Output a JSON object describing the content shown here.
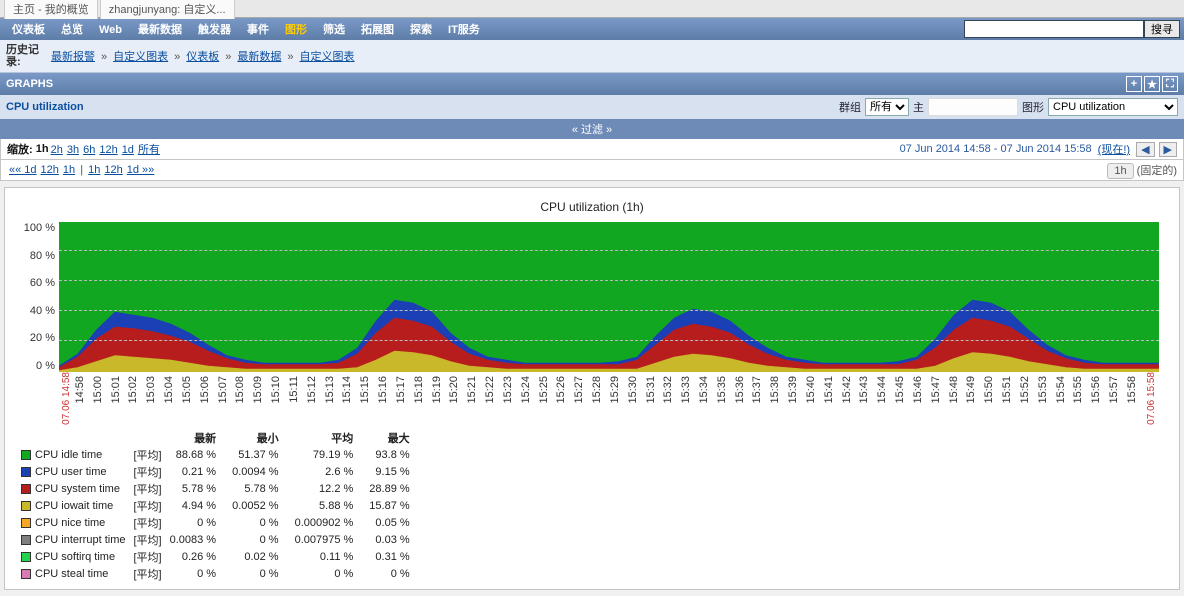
{
  "topTabs": [
    "主页 - 我的概览",
    "zhangjunyang: 自定义..."
  ],
  "menu": [
    "仪表板",
    "总览",
    "Web",
    "最新数据",
    "触发器",
    "事件",
    "图形",
    "筛选",
    "拓展图",
    "探索",
    "IT服务"
  ],
  "menuActive": "图形",
  "searchBtn": "搜寻",
  "history": {
    "label": "历史记录:",
    "items": [
      "最新报警",
      "自定义图表",
      "仪表板",
      "最新数据",
      "自定义图表"
    ]
  },
  "barTitle": "GRAPHS",
  "subbar": {
    "title": "CPU utilization",
    "groupLabel": "群组",
    "groupValue": "所有",
    "hostLabel": "主",
    "hostValue": "",
    "graphLabel": "图形",
    "graphValue": "CPU utilization"
  },
  "filterLabel": "« 过滤 »",
  "zoom": {
    "label": "缩放:",
    "active": "1h",
    "options": [
      "2h",
      "3h",
      "6h",
      "12h",
      "1d",
      "所有"
    ],
    "range": "07 Jun 2014 14:58  -  07 Jun 2014 15:58",
    "now": "(现在!)"
  },
  "pager": {
    "left": [
      "«« 1d",
      "12h",
      "1h",
      " | ",
      "1h",
      "12h",
      "1d »»"
    ],
    "right": "1h",
    "fixed": "(固定的)"
  },
  "chart_data": {
    "type": "area",
    "title": "CPU utilization (1h)",
    "ylabel": "",
    "ylim": [
      0,
      100
    ],
    "yticks": [
      0,
      20,
      40,
      60,
      80,
      100
    ],
    "x": [
      "14:58",
      "15:00",
      "15:01",
      "15:02",
      "15:03",
      "15:04",
      "15:05",
      "15:06",
      "15:07",
      "15:08",
      "15:09",
      "15:10",
      "15:11",
      "15:12",
      "15:13",
      "15:14",
      "15:15",
      "15:16",
      "15:17",
      "15:18",
      "15:19",
      "15:20",
      "15:21",
      "15:22",
      "15:23",
      "15:24",
      "15:25",
      "15:26",
      "15:27",
      "15:28",
      "15:29",
      "15:30",
      "15:31",
      "15:32",
      "15:33",
      "15:34",
      "15:35",
      "15:36",
      "15:37",
      "15:38",
      "15:39",
      "15:40",
      "15:41",
      "15:42",
      "15:43",
      "15:44",
      "15:45",
      "15:46",
      "15:47",
      "15:48",
      "15:49",
      "15:50",
      "15:51",
      "15:52",
      "15:53",
      "15:54",
      "15:55",
      "15:56",
      "15:57",
      "15:58"
    ],
    "x_start": "07.06 14:58",
    "x_end": "07.06 15:58",
    "series": [
      {
        "name": "CPU iowait time",
        "color": "#c9b82a",
        "values": [
          1,
          3,
          7,
          11,
          10,
          9,
          8,
          6,
          4,
          3,
          2,
          2,
          2,
          2,
          2,
          2,
          3,
          8,
          14,
          13,
          11,
          7,
          4,
          3,
          2,
          2,
          2,
          2,
          2,
          2,
          2,
          2,
          6,
          10,
          12,
          11,
          9,
          6,
          4,
          3,
          2,
          2,
          2,
          2,
          2,
          2,
          2,
          4,
          9,
          13,
          12,
          10,
          7,
          5,
          3,
          2,
          2,
          2,
          2,
          2
        ]
      },
      {
        "name": "CPU system time",
        "color": "#b81d1d",
        "values": [
          3,
          10,
          22,
          30,
          29,
          27,
          24,
          20,
          14,
          9,
          6,
          5,
          5,
          5,
          5,
          6,
          12,
          26,
          36,
          34,
          30,
          20,
          12,
          8,
          6,
          5,
          5,
          5,
          5,
          5,
          5,
          8,
          18,
          28,
          32,
          30,
          26,
          18,
          12,
          8,
          6,
          5,
          5,
          5,
          5,
          5,
          8,
          16,
          28,
          36,
          34,
          30,
          22,
          14,
          9,
          6,
          5,
          5,
          5,
          5
        ]
      },
      {
        "name": "CPU user time",
        "color": "#1b3fb5",
        "values": [
          4,
          12,
          28,
          40,
          38,
          36,
          32,
          26,
          18,
          11,
          8,
          6,
          6,
          6,
          6,
          8,
          16,
          34,
          48,
          46,
          40,
          26,
          16,
          10,
          8,
          6,
          6,
          6,
          6,
          6,
          7,
          10,
          24,
          36,
          42,
          40,
          34,
          24,
          16,
          10,
          8,
          6,
          6,
          6,
          6,
          7,
          10,
          22,
          38,
          48,
          46,
          40,
          28,
          18,
          11,
          8,
          6,
          6,
          6,
          6
        ]
      },
      {
        "name": "CPU idle time",
        "color": "#12a720",
        "values": [
          100,
          100,
          100,
          100,
          100,
          100,
          100,
          100,
          100,
          100,
          100,
          100,
          100,
          100,
          100,
          100,
          100,
          100,
          100,
          100,
          100,
          100,
          100,
          100,
          100,
          100,
          100,
          100,
          100,
          100,
          100,
          100,
          100,
          100,
          100,
          100,
          100,
          100,
          100,
          100,
          100,
          100,
          100,
          100,
          100,
          100,
          100,
          100,
          100,
          100,
          100,
          100,
          100,
          100,
          100,
          100,
          100,
          100,
          100,
          100
        ]
      }
    ],
    "legend_cols": [
      "最新",
      "最小",
      "平均",
      "最大"
    ],
    "legend_agg": "[平均]",
    "legend": [
      {
        "name": "CPU idle time",
        "color": "#12a720",
        "vals": [
          "88.68 %",
          "51.37 %",
          "79.19 %",
          "93.8 %"
        ]
      },
      {
        "name": "CPU user time",
        "color": "#1b3fb5",
        "vals": [
          "0.21 %",
          "0.0094 %",
          "2.6 %",
          "9.15 %"
        ]
      },
      {
        "name": "CPU system time",
        "color": "#b81d1d",
        "vals": [
          "5.78 %",
          "5.78 %",
          "12.2 %",
          "28.89 %"
        ]
      },
      {
        "name": "CPU iowait time",
        "color": "#c9b82a",
        "vals": [
          "4.94 %",
          "0.0052 %",
          "5.88 %",
          "15.87 %"
        ]
      },
      {
        "name": "CPU nice time",
        "color": "#f5a623",
        "vals": [
          "0 %",
          "0 %",
          "0.000902 %",
          "0.05 %"
        ]
      },
      {
        "name": "CPU interrupt time",
        "color": "#7e7e7e",
        "vals": [
          "0.0083 %",
          "0 %",
          "0.007975 %",
          "0.03 %"
        ]
      },
      {
        "name": "CPU softirq time",
        "color": "#22d44a",
        "vals": [
          "0.26 %",
          "0.02 %",
          "0.11 %",
          "0.31 %"
        ]
      },
      {
        "name": "CPU steal time",
        "color": "#d97ab0",
        "vals": [
          "0 %",
          "0 %",
          "0 %",
          "0 %"
        ]
      }
    ]
  }
}
